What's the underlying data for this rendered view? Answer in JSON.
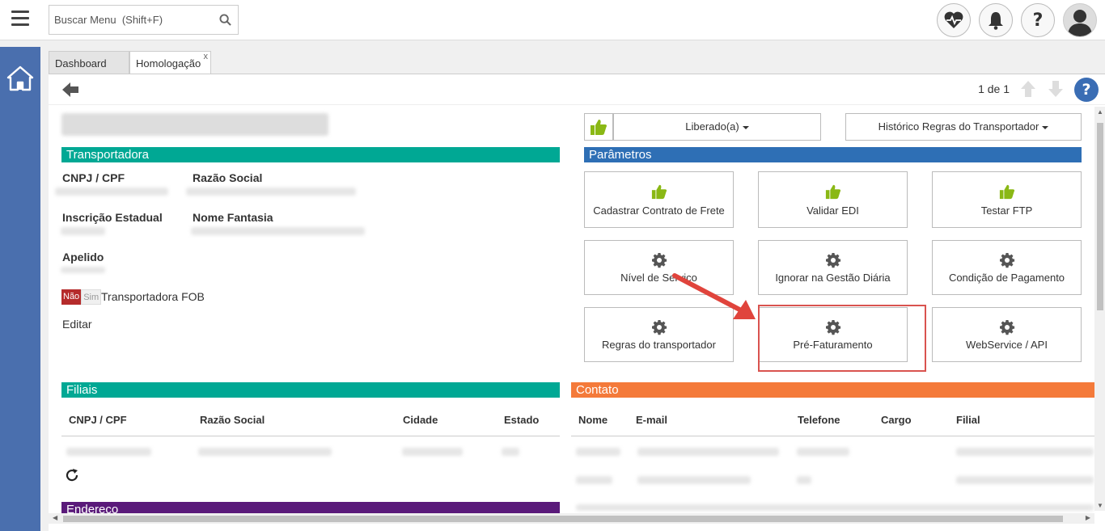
{
  "header": {
    "search_placeholder": "Buscar Menu  (Shift+F)",
    "icons": [
      "menu-icon",
      "search-icon",
      "heartbeat-icon",
      "bell-icon",
      "help-icon",
      "user-avatar-icon"
    ],
    "help_label": "?"
  },
  "sidebar": {
    "icon": "home-icon"
  },
  "tabs": [
    {
      "label": "Dashboard"
    },
    {
      "label": "Homologação",
      "close": "x"
    }
  ],
  "toolbar": {
    "pager": "1 de 1",
    "help": "?"
  },
  "transportadora": {
    "header": "Transportadora",
    "header_color": "#00a894",
    "labels": {
      "cnpj": "CNPJ / CPF",
      "razao": "Razão Social",
      "inscricao": "Inscrição Estadual",
      "fantasia": "Nome Fantasia",
      "apelido": "Apelido"
    },
    "toggle": {
      "no": "Não",
      "yes": "Sim",
      "label": "Transportadora FOB"
    },
    "edit": "Editar"
  },
  "status": {
    "liberado": "Liberado(a)",
    "historico": "Histórico Regras do Transportador"
  },
  "parametros": {
    "header": "Parâmetros",
    "header_color": "#2e6fb5",
    "buttons": [
      {
        "label": "Cadastrar Contrato de Frete",
        "icon": "thumbs-up-icon"
      },
      {
        "label": "Validar EDI",
        "icon": "thumbs-up-icon"
      },
      {
        "label": "Testar FTP",
        "icon": "thumbs-up-icon"
      },
      {
        "label": "Nível de Serviço",
        "icon": "gear-icon"
      },
      {
        "label": "Ignorar na Gestão Diária",
        "icon": "gear-icon"
      },
      {
        "label": "Condição de Pagamento",
        "icon": "gear-icon"
      },
      {
        "label": "Regras do transportador",
        "icon": "gear-icon"
      },
      {
        "label": "Pré-Faturamento",
        "icon": "gear-icon"
      },
      {
        "label": "WebService / API",
        "icon": "gear-icon"
      }
    ]
  },
  "filiais": {
    "header": "Filiais",
    "header_color": "#00a894",
    "columns": [
      "CNPJ / CPF",
      "Razão Social",
      "Cidade",
      "Estado"
    ]
  },
  "contato": {
    "header": "Contato",
    "header_color": "#f47a3a",
    "columns": [
      "Nome",
      "E-mail",
      "Telefone",
      "Cargo",
      "Filial"
    ]
  },
  "endereco": {
    "header": "Endereço",
    "header_color": "#5a1a7a"
  }
}
